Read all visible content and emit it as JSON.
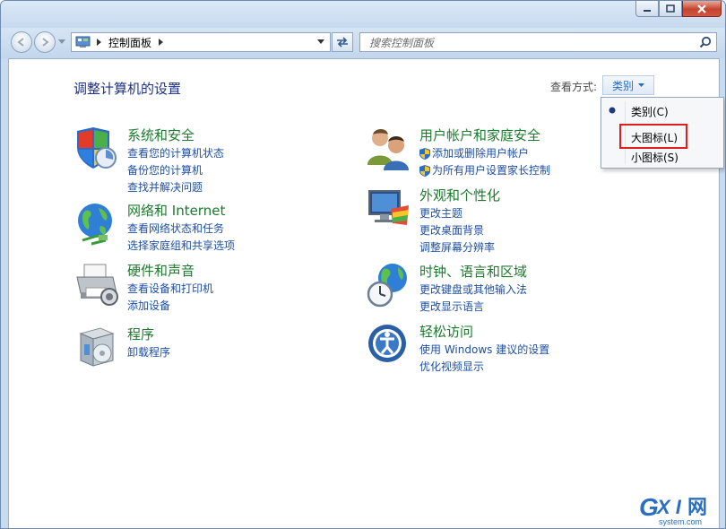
{
  "window": {
    "breadcrumb": "控制面板",
    "search_placeholder": "搜索控制面板"
  },
  "main": {
    "heading": "调整计算机的设置",
    "view_by_label": "查看方式:",
    "view_by_value": "类别"
  },
  "categories": [
    {
      "title": "系统和安全",
      "links": [
        "查看您的计算机状态",
        "备份您的计算机",
        "查找并解决问题"
      ]
    },
    {
      "title": "网络和 Internet",
      "links": [
        "查看网络状态和任务",
        "选择家庭组和共享选项"
      ]
    },
    {
      "title": "硬件和声音",
      "links": [
        "查看设备和打印机",
        "添加设备"
      ]
    },
    {
      "title": "程序",
      "links": [
        "卸载程序"
      ]
    },
    {
      "title": "用户帐户和家庭安全",
      "links": [
        "添加或删除用户帐户",
        "为所有用户设置家长控制"
      ]
    },
    {
      "title": "外观和个性化",
      "links": [
        "更改主题",
        "更改桌面背景",
        "调整屏幕分辨率"
      ]
    },
    {
      "title": "时钟、语言和区域",
      "links": [
        "更改键盘或其他输入法",
        "更改显示语言"
      ]
    },
    {
      "title": "轻松访问",
      "links": [
        "使用 Windows 建议的设置",
        "优化视频显示"
      ]
    }
  ],
  "view_menu": {
    "items": [
      "类别(C)",
      "大图标(L)",
      "小图标(S)"
    ],
    "selected_index": 0
  },
  "watermark": {
    "brand": "GXI网",
    "domain": "system.com"
  },
  "colors": {
    "title_green": "#1d7a2e",
    "link_blue": "#1e4fa3",
    "heading_blue": "#1e3287",
    "highlight_red": "#e02020"
  }
}
